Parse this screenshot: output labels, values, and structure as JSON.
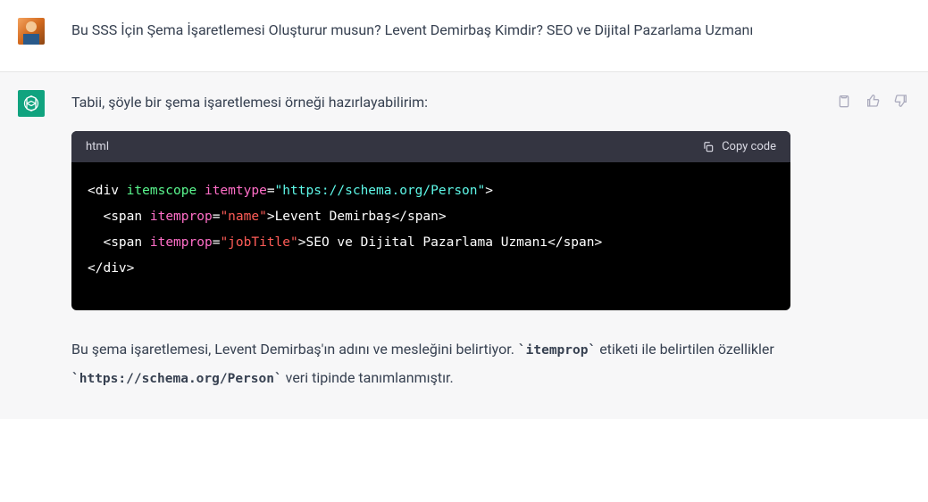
{
  "user_message": {
    "text": "Bu SSS İçin Şema İşaretlemesi Oluşturur musun? Levent Demirbaş Kimdir?  SEO ve Dijital Pazarlama Uzmanı"
  },
  "assistant_message": {
    "intro_text": "Tabii, şöyle bir şema işaretlemesi örneği hazırlayabilirim:",
    "code_language": "html",
    "copy_button_label": "Copy code",
    "code": {
      "line1_open": "<div",
      "line1_itemscope": " itemscope",
      "line1_itemtype_attr": " itemtype",
      "line1_eq": "=",
      "line1_itemtype_val": "\"https://schema.org/Person\"",
      "line1_close": ">",
      "line2_indent": "  ",
      "line2_span_open": "<span",
      "line2_itemprop_attr": " itemprop",
      "line2_eq": "=",
      "line2_itemprop_val": "\"name\"",
      "line2_gt": ">",
      "line2_text": "Levent Demirbaş",
      "line2_span_close": "</span>",
      "line3_indent": "  ",
      "line3_span_open": "<span",
      "line3_itemprop_attr": " itemprop",
      "line3_eq": "=",
      "line3_itemprop_val": "\"jobTitle\"",
      "line3_gt": ">",
      "line3_text": "SEO ve Dijital Pazarlama Uzmanı",
      "line3_span_close": "</span>",
      "line4_close": "</div>"
    },
    "post_text_part1": "Bu şema işaretlemesi, Levent Demirbaş'ın adını ve mesleğini belirtiyor. ",
    "post_code1": "`itemprop`",
    "post_text_part2": " etiketi ile belirtilen özellikler ",
    "post_code2": "`https://schema.org/Person`",
    "post_text_part3": " veri tipinde tanımlanmıştır."
  }
}
